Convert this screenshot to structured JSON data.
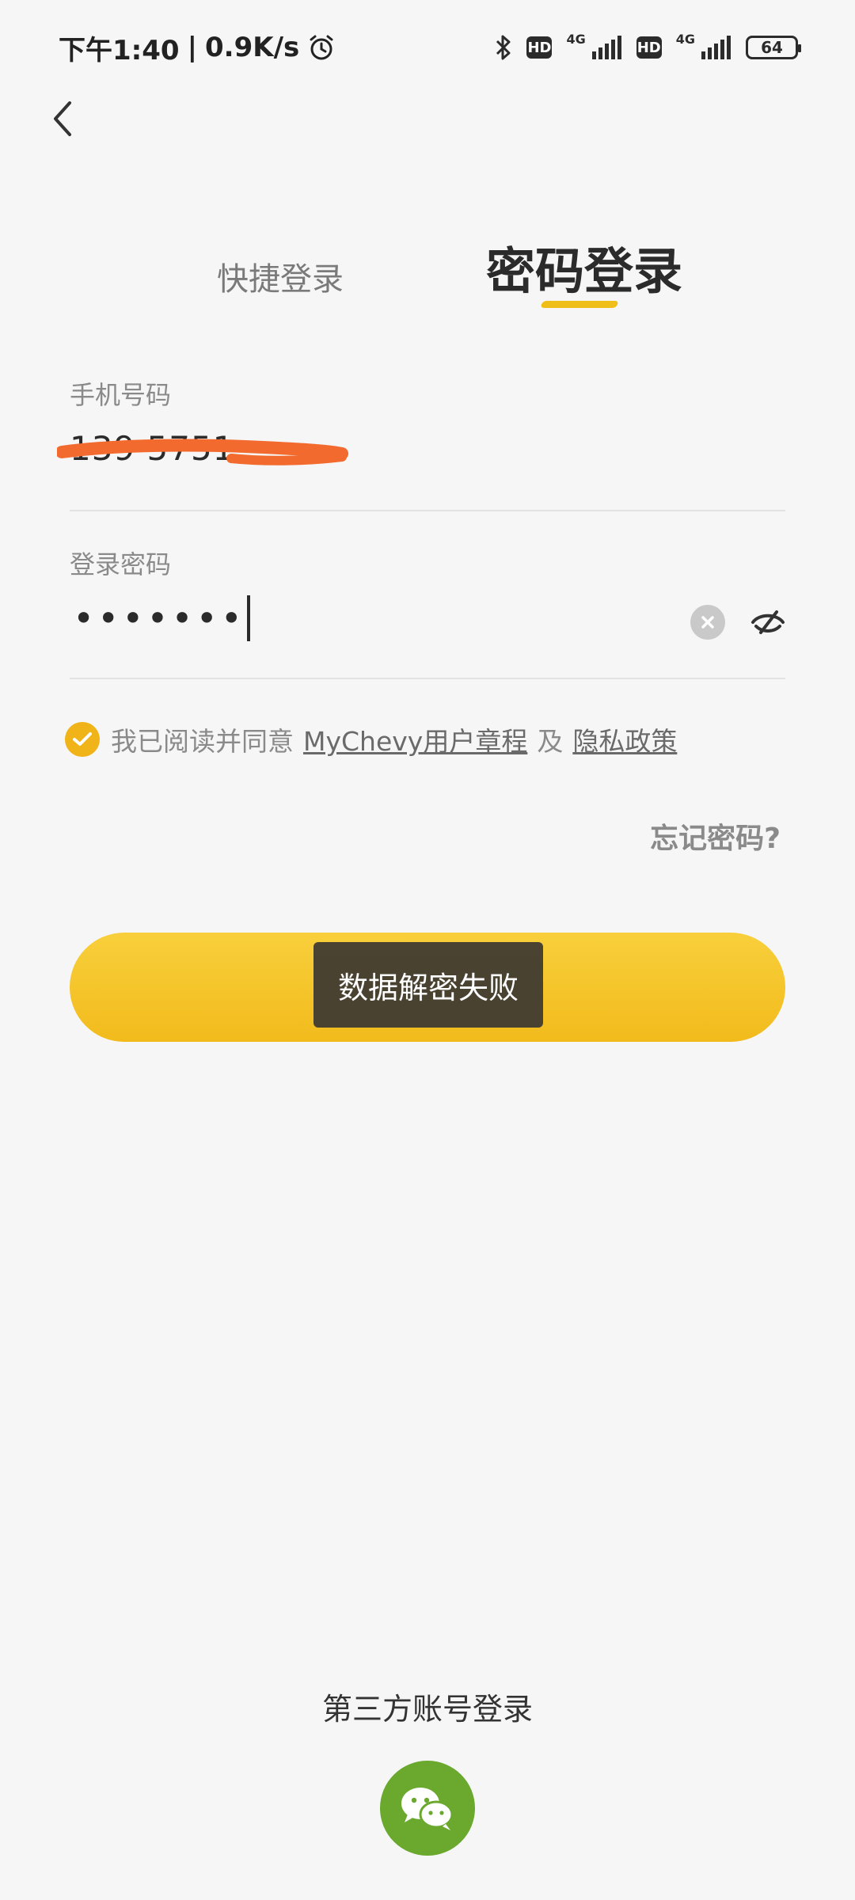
{
  "status_bar": {
    "time": "下午1:40",
    "separator": "|",
    "net_speed": "0.9K/s",
    "hd_label_1": "HD",
    "net_type_1": "4G",
    "hd_label_2": "HD",
    "net_type_2": "4G",
    "battery": "64"
  },
  "tabs": {
    "quick_login": "快捷登录",
    "password_login": "密码登录"
  },
  "form": {
    "phone_label": "手机号码",
    "phone_value": "139 5751 ",
    "password_label": "登录密码",
    "password_value": "•••••••"
  },
  "agreement": {
    "prefix": "我已阅读并同意",
    "terms_link": "MyChevy用户章程",
    "and": "及",
    "privacy_link": "隐私政策"
  },
  "forgot_password": "忘记密码?",
  "toast": "数据解密失败",
  "third_party": {
    "label": "第三方账号登录"
  },
  "colors": {
    "accent": "#f0be18",
    "button": "#f5c42a",
    "wechat": "#6aa82e",
    "redact": "#f26a2e"
  }
}
